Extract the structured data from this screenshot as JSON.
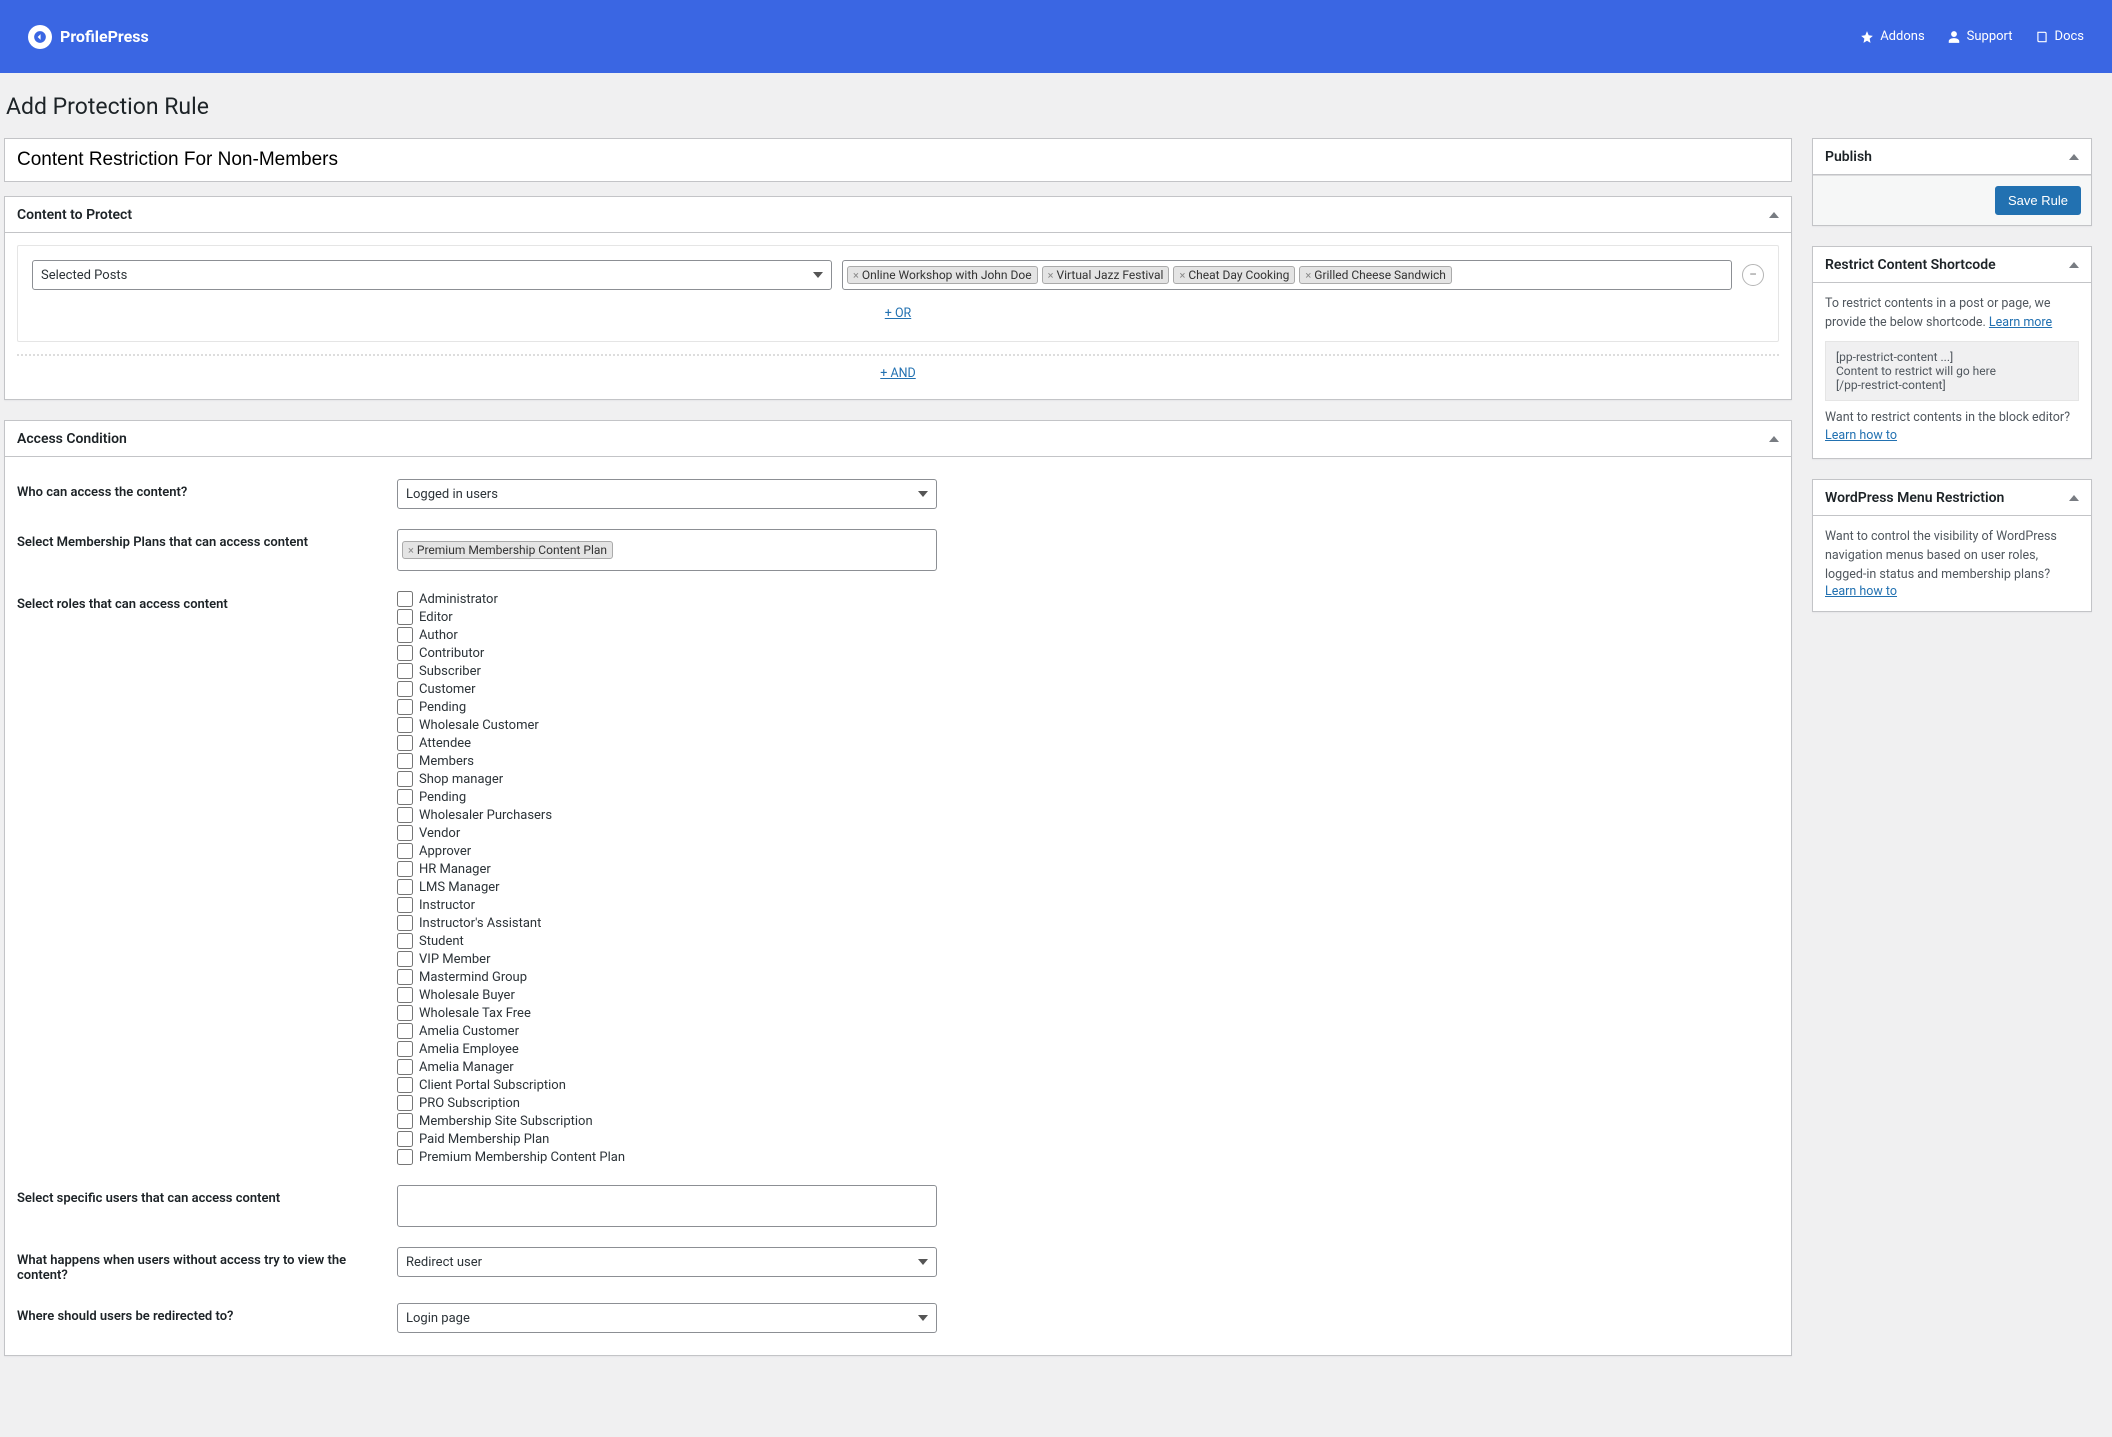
{
  "brand": {
    "name": "ProfilePress"
  },
  "topnav": {
    "addons": "Addons",
    "support": "Support",
    "docs": "Docs"
  },
  "page": {
    "title": "Add Protection Rule"
  },
  "titleInput": {
    "value": "Content Restriction For Non-Members"
  },
  "contentProtect": {
    "heading": "Content to Protect",
    "selectLabel": "Selected Posts",
    "tags": [
      "Online Workshop with John Doe",
      "Virtual Jazz Festival",
      "Cheat Day Cooking",
      "Grilled Cheese Sandwich"
    ],
    "orLink": "+ OR",
    "andLink": "+ AND"
  },
  "accessCondition": {
    "heading": "Access Condition",
    "whoLabel": "Who can access the content?",
    "whoValue": "Logged in users",
    "plansLabel": "Select Membership Plans that can access content",
    "plansTags": [
      "Premium Membership Content Plan"
    ],
    "rolesLabel": "Select roles that can access content",
    "roles": [
      "Administrator",
      "Editor",
      "Author",
      "Contributor",
      "Subscriber",
      "Customer",
      "Pending",
      "Wholesale Customer",
      "Attendee",
      "Members",
      "Shop manager",
      "Pending",
      "Wholesaler Purchasers",
      "Vendor",
      "Approver",
      "HR Manager",
      "LMS Manager",
      "Instructor",
      "Instructor's Assistant",
      "Student",
      "VIP Member",
      "Mastermind Group",
      "Wholesale Buyer",
      "Wholesale Tax Free",
      "Amelia Customer",
      "Amelia Employee",
      "Amelia Manager",
      "Client Portal Subscription",
      "PRO Subscription",
      "Membership Site Subscription",
      "Paid Membership Plan",
      "Premium Membership Content Plan"
    ],
    "usersLabel": "Select specific users that can access content",
    "noaccessLabel": "What happens when users without access try to view the content?",
    "noaccessValue": "Redirect user",
    "redirectLabel": "Where should users be redirected to?",
    "redirectValue": "Login page"
  },
  "publish": {
    "heading": "Publish",
    "button": "Save Rule"
  },
  "shortcodeBox": {
    "heading": "Restrict Content Shortcode",
    "desc": "To restrict contents in a post or page, we provide the below shortcode.",
    "learnMore": "Learn more",
    "code1": "[pp-restrict-content ...]",
    "code2": "Content to restrict will go here",
    "code3": "[/pp-restrict-content]",
    "blockDesc": "Want to restrict contents in the block editor?",
    "learnHow": "Learn how to"
  },
  "menuBox": {
    "heading": "WordPress Menu Restriction",
    "desc": "Want to control the visibility of WordPress navigation menus based on user roles, logged-in status and membership plans?",
    "learnHow": "Learn how to"
  }
}
